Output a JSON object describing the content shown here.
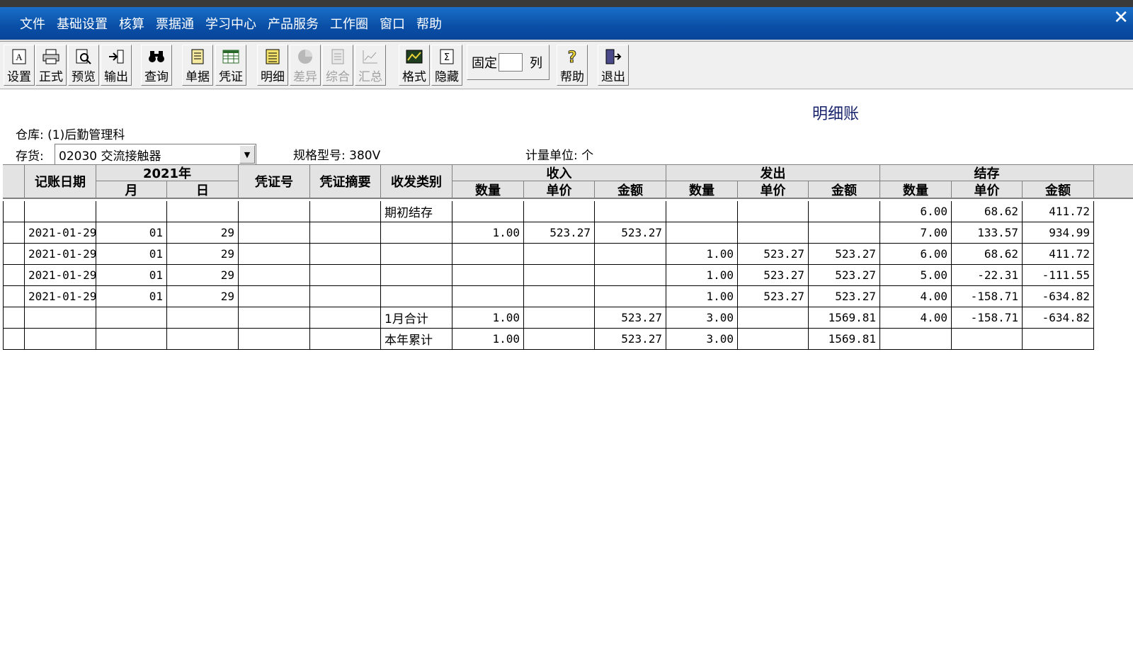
{
  "window": {
    "close_glyph": "✕"
  },
  "menu": [
    "文件",
    "基础设置",
    "核算",
    "票据通",
    "学习中心",
    "产品服务",
    "工作圈",
    "窗口",
    "帮助"
  ],
  "toolbar": {
    "buttons": [
      {
        "label": "设置",
        "icon": "page-setup-icon",
        "enabled": true
      },
      {
        "label": "正式",
        "icon": "printer-icon",
        "enabled": true
      },
      {
        "label": "预览",
        "icon": "print-preview-icon",
        "enabled": true
      },
      {
        "label": "输出",
        "icon": "export-icon",
        "enabled": true
      },
      {
        "label": "查询",
        "icon": "binoculars-icon",
        "enabled": true
      },
      {
        "label": "单据",
        "icon": "document-icon",
        "enabled": true
      },
      {
        "label": "凭证",
        "icon": "voucher-grid-icon",
        "enabled": true
      },
      {
        "label": "明细",
        "icon": "detail-list-icon",
        "enabled": true
      },
      {
        "label": "差异",
        "icon": "pie-icon",
        "enabled": false
      },
      {
        "label": "综合",
        "icon": "summary-doc-icon",
        "enabled": false
      },
      {
        "label": "汇总",
        "icon": "chart-icon",
        "enabled": false
      },
      {
        "label": "格式",
        "icon": "format-icon",
        "enabled": true
      },
      {
        "label": "隐藏",
        "icon": "sigma-icon",
        "enabled": true
      },
      {
        "label": "帮助",
        "icon": "help-icon",
        "enabled": true
      },
      {
        "label": "退出",
        "icon": "exit-door-icon",
        "enabled": true
      }
    ],
    "fixed_label": "固定",
    "fixed_value": "",
    "col_label": "列"
  },
  "report": {
    "title": "明细账",
    "warehouse_label": "仓库:",
    "warehouse_value": "(1)后勤管理科",
    "inventory_label": "存货:",
    "inventory_value": "02030 交流接触器",
    "spec_label": "规格型号:",
    "spec_value": "380V",
    "unit_label": "计量单位:",
    "unit_value": "个"
  },
  "table": {
    "headers": {
      "date": "记账日期",
      "year": "2021年",
      "month": "月",
      "day": "日",
      "voucher_no": "凭证号",
      "voucher_summary": "凭证摘要",
      "category": "收发类别",
      "in": "收入",
      "out": "发出",
      "balance": "结存",
      "qty": "数量",
      "price": "单价",
      "amount": "金额"
    },
    "rows": [
      [
        "",
        "",
        "",
        "",
        "",
        "期初结存",
        "",
        "",
        "",
        "",
        "",
        "",
        "6.00",
        "68.62",
        "411.72"
      ],
      [
        "2021-01-29",
        "01",
        "29",
        "",
        "",
        "",
        "1.00",
        "523.27",
        "523.27",
        "",
        "",
        "",
        "7.00",
        "133.57",
        "934.99"
      ],
      [
        "2021-01-29",
        "01",
        "29",
        "",
        "",
        "",
        "",
        "",
        "",
        "1.00",
        "523.27",
        "523.27",
        "6.00",
        "68.62",
        "411.72"
      ],
      [
        "2021-01-29",
        "01",
        "29",
        "",
        "",
        "",
        "",
        "",
        "",
        "1.00",
        "523.27",
        "523.27",
        "5.00",
        "-22.31",
        "-111.55"
      ],
      [
        "2021-01-29",
        "01",
        "29",
        "",
        "",
        "",
        "",
        "",
        "",
        "1.00",
        "523.27",
        "523.27",
        "4.00",
        "-158.71",
        "-634.82"
      ],
      [
        "",
        "",
        "",
        "",
        "",
        "1月合计",
        "1.00",
        "",
        "523.27",
        "3.00",
        "",
        "1569.81",
        "4.00",
        "-158.71",
        "-634.82"
      ],
      [
        "",
        "",
        "",
        "",
        "",
        "本年累计",
        "1.00",
        "",
        "523.27",
        "3.00",
        "",
        "1569.81",
        "",
        "",
        ""
      ]
    ]
  }
}
